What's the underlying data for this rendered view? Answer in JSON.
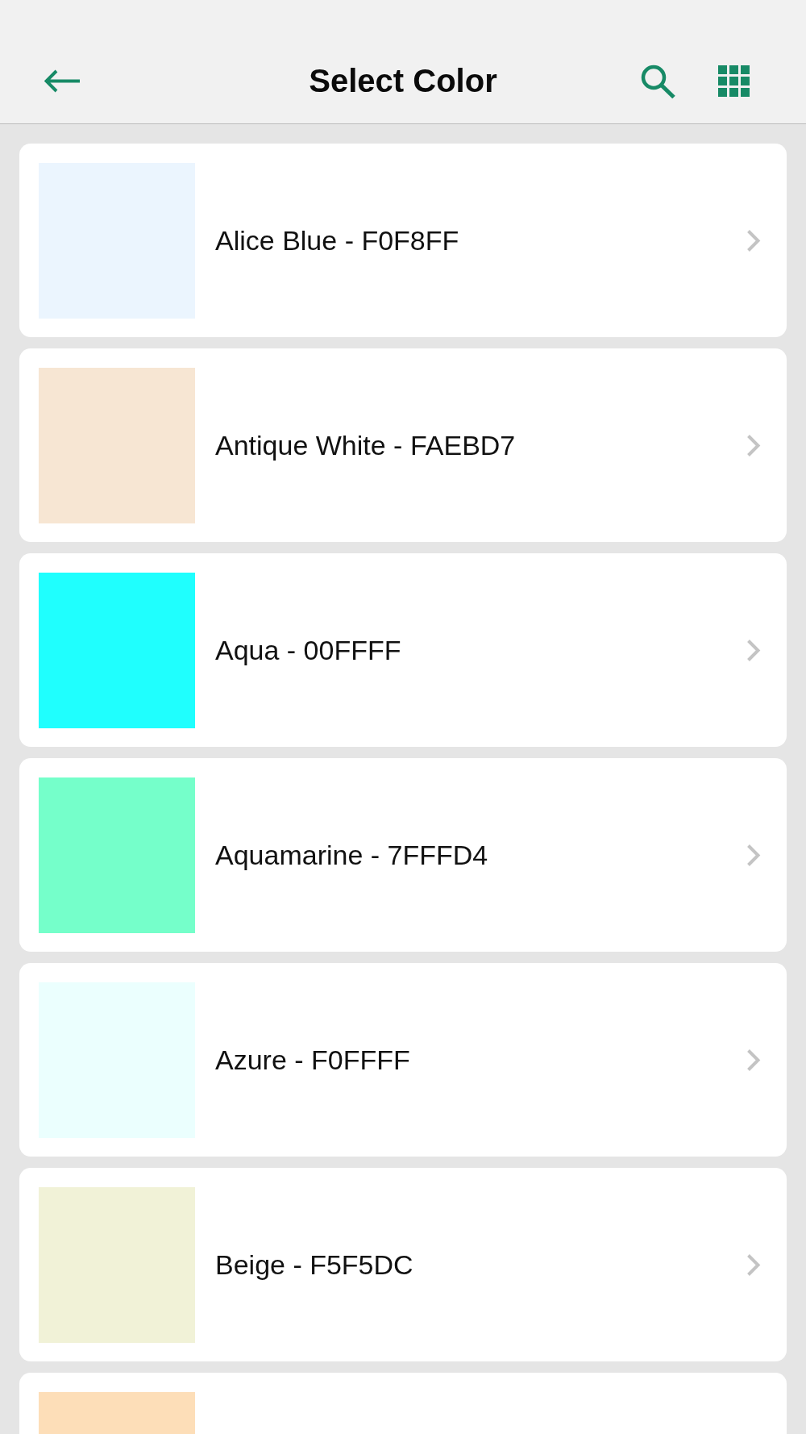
{
  "header": {
    "title": "Select Color"
  },
  "colors": [
    {
      "label": "Alice Blue - F0F8FF",
      "color": "#ebf5fe"
    },
    {
      "label": "Antique White - FAEBD7",
      "color": "#f7e6d3"
    },
    {
      "label": "Aqua - 00FFFF",
      "color": "#1ffffe"
    },
    {
      "label": "Aquamarine - 7FFFD4",
      "color": "#75ffca"
    },
    {
      "label": "Azure - F0FFFF",
      "color": "#ebfffe"
    },
    {
      "label": "Beige - F5F5DC",
      "color": "#f1f2d7"
    },
    {
      "color": "#fddeb8"
    }
  ]
}
